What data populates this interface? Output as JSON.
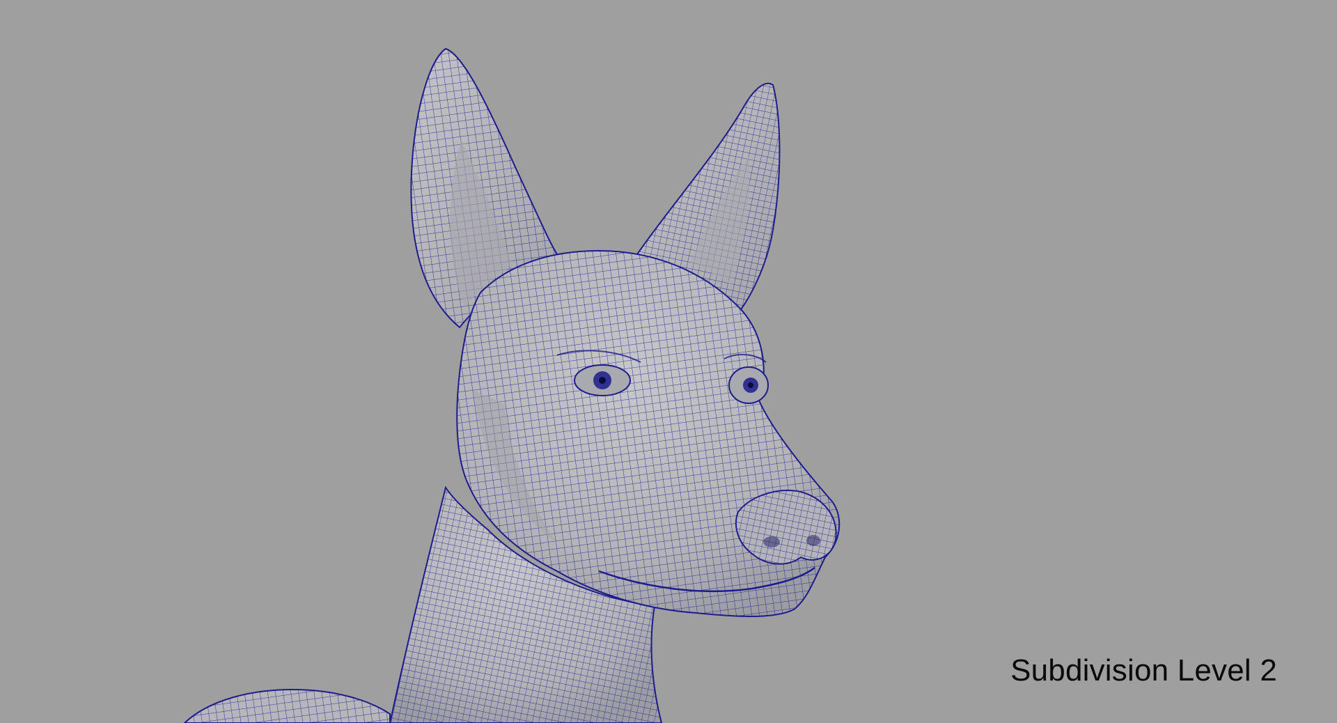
{
  "viewport": {
    "background_color": "#9f9f9f",
    "model_subject": "dog-head-wireframe",
    "mesh_surface_color": "#b9b9bd",
    "wire_color": "#1c1c8c"
  },
  "caption": {
    "text": "Subdivision Level 2"
  }
}
